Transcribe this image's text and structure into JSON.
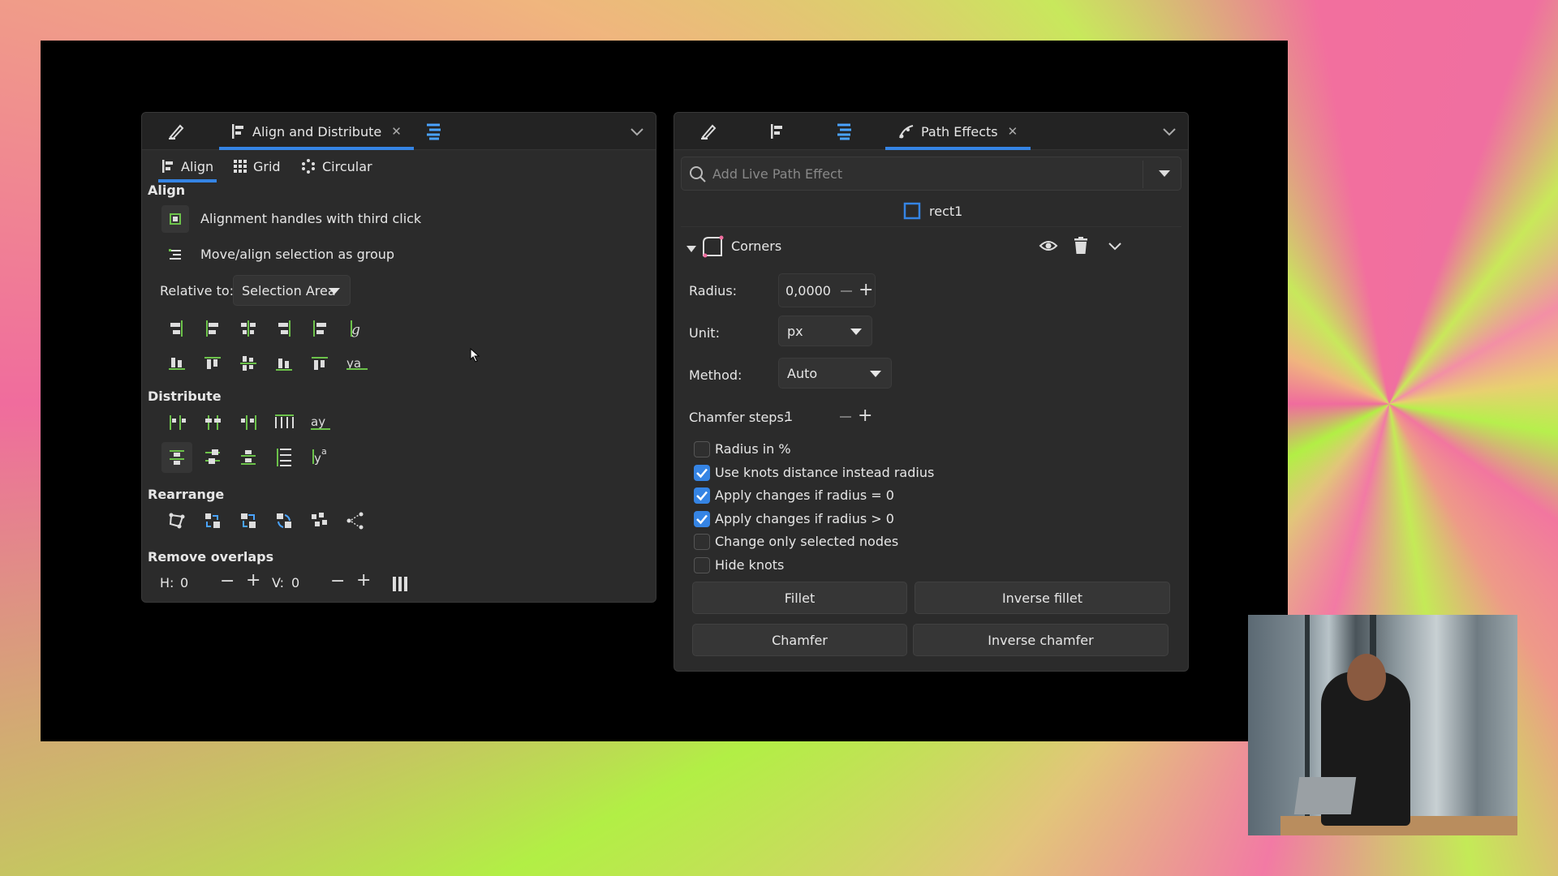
{
  "left_panel": {
    "tabs": [
      {
        "label": "Align and Distribute",
        "icon": "align-icon"
      }
    ],
    "subtabs": [
      "Align",
      "Grid",
      "Circular"
    ],
    "sections": {
      "align": "Align",
      "distribute": "Distribute",
      "rearrange": "Rearrange",
      "remove_overlaps": "Remove overlaps"
    },
    "options": {
      "alignment_handles": "Alignment handles with third click",
      "move_as_group": "Move/align selection as group"
    },
    "relative_to": {
      "label": "Relative to:",
      "value": "Selection Area"
    },
    "overlaps": {
      "h_label": "H:",
      "h_value": "0",
      "v_label": "V:",
      "v_value": "0"
    }
  },
  "right_panel": {
    "tabs": [
      {
        "label": "Path Effects",
        "icon": "path-effects-icon"
      }
    ],
    "search": {
      "placeholder": "Add Live Path Effect"
    },
    "object_name": "rect1",
    "effect": {
      "name": "Corners"
    },
    "fields": {
      "radius": {
        "label": "Radius:",
        "value": "0,0000"
      },
      "unit": {
        "label": "Unit:",
        "value": "px"
      },
      "method": {
        "label": "Method:",
        "value": "Auto"
      },
      "chamfer_steps": {
        "label": "Chamfer steps:",
        "value": "1"
      }
    },
    "checkboxes": [
      {
        "label": "Radius in %",
        "checked": false
      },
      {
        "label": "Use knots distance instead radius",
        "checked": true
      },
      {
        "label": "Apply changes if radius = 0",
        "checked": true
      },
      {
        "label": "Apply changes if radius > 0",
        "checked": true
      },
      {
        "label": "Change only selected nodes",
        "checked": false
      },
      {
        "label": "Hide knots",
        "checked": false
      }
    ],
    "buttons": {
      "fillet": "Fillet",
      "inverse_fillet": "Inverse fillet",
      "chamfer": "Chamfer",
      "inverse_chamfer": "Inverse chamfer"
    }
  },
  "colors": {
    "accent": "#3584e4",
    "icon_green": "#6cc24a",
    "panel_bg": "#2b2b2b"
  }
}
